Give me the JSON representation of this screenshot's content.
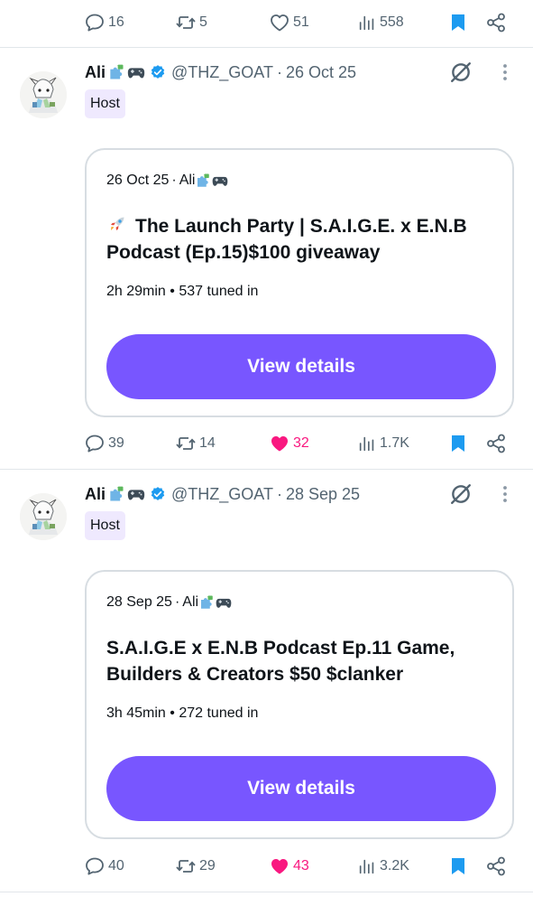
{
  "top_action_bar": {
    "reply_count": "16",
    "repost_count": "5",
    "like_count": "51",
    "view_count": "558"
  },
  "posts": [
    {
      "author_name": "Ali",
      "handle": "@THZ_GOAT",
      "date": "26 Oct 25",
      "badge": "Host",
      "card": {
        "meta_date": "26 Oct 25",
        "meta_host": "Ali",
        "title": "The Launch Party | S.A.I.G.E. x E.N.B Podcast (Ep.15)$100 giveaway",
        "duration": "2h 29min",
        "tuned_in": "537 tuned in",
        "button_label": "View details"
      },
      "actions": {
        "reply_count": "39",
        "repost_count": "14",
        "like_count": "32",
        "view_count": "1.7K",
        "liked": true
      }
    },
    {
      "author_name": "Ali",
      "handle": "@THZ_GOAT",
      "date": "28 Sep 25",
      "badge": "Host",
      "card": {
        "meta_date": "28 Sep 25",
        "meta_host": "Ali",
        "title": "S.A.I.G.E x E.N.B Podcast Ep.11 Game, Builders & Creators $50 $clanker",
        "duration": "3h 45min",
        "tuned_in": "272 tuned in",
        "button_label": "View details"
      },
      "actions": {
        "reply_count": "40",
        "repost_count": "29",
        "like_count": "43",
        "view_count": "3.2K",
        "liked": true
      }
    }
  ],
  "separator_dot": "·",
  "stats_separator": "•",
  "colors": {
    "accent_purple": "#7856ff",
    "host_badge_bg": "#efe9fe",
    "like_pink": "#f91880",
    "bookmark_blue": "#1d9bf0",
    "muted_text": "#536471"
  },
  "icons": {
    "reply": "reply-icon",
    "repost": "repost-icon",
    "like": "heart-icon",
    "views": "views-icon",
    "bookmark": "bookmark-icon",
    "share": "share-icon",
    "verified": "verified-badge-icon",
    "spaces": "spaces-icon",
    "more": "more-icon",
    "rocket": "rocket-icon",
    "puzzle": "puzzle-icon",
    "gamepad": "gamepad-icon"
  }
}
